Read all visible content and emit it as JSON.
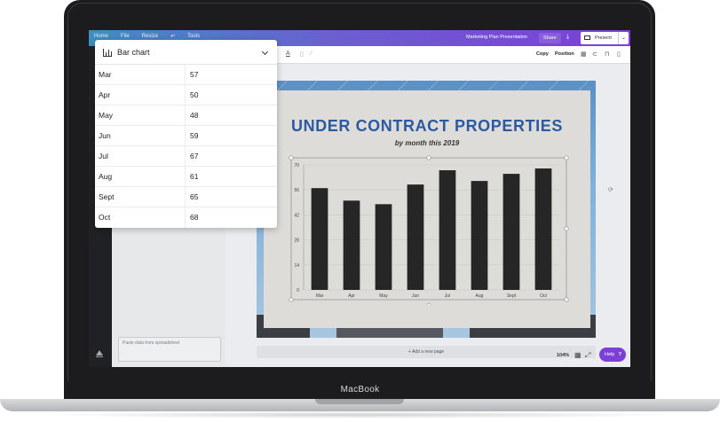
{
  "app": {
    "nav": [
      "Home",
      "File",
      "Resize",
      "↶",
      "Tools"
    ],
    "doc_title": "Marketing Plan Presentation",
    "share_label": "Share",
    "present_label": "Present"
  },
  "toolbar": {
    "copy_label": "Copy",
    "position_label": "Position"
  },
  "slide": {
    "title": "UNDER CONTRACT PROPERTIES",
    "subtitle": "by month this 2019"
  },
  "editor": {
    "chart_type_label": "Bar chart",
    "rows": [
      {
        "label": "Mar",
        "value": "57"
      },
      {
        "label": "Apr",
        "value": "50"
      },
      {
        "label": "May",
        "value": "48"
      },
      {
        "label": "Jun",
        "value": "59"
      },
      {
        "label": "Jul",
        "value": "67"
      },
      {
        "label": "Aug",
        "value": "61"
      },
      {
        "label": "Sept",
        "value": "65"
      },
      {
        "label": "Oct",
        "value": "68"
      }
    ],
    "paste_placeholder": "Paste data from spreadsheet"
  },
  "footer": {
    "add_page_label": "+ Add a new page",
    "zoom": "104%",
    "help_label": "Help",
    "help_glyph": "?"
  },
  "device": {
    "brand": "MacBook"
  },
  "colors": {
    "accent": "#7d3fd6",
    "bar": "#262626",
    "title_blue": "#2b5aa3"
  },
  "chart_data": {
    "type": "bar",
    "categories": [
      "Mar",
      "Apr",
      "May",
      "Jun",
      "Jul",
      "Aug",
      "Sept",
      "Oct"
    ],
    "values": [
      57,
      50,
      48,
      59,
      67,
      61,
      65,
      68
    ],
    "ylim": [
      0,
      70
    ],
    "yticks": [
      0,
      14,
      28,
      42,
      56,
      70
    ],
    "grid": true
  }
}
